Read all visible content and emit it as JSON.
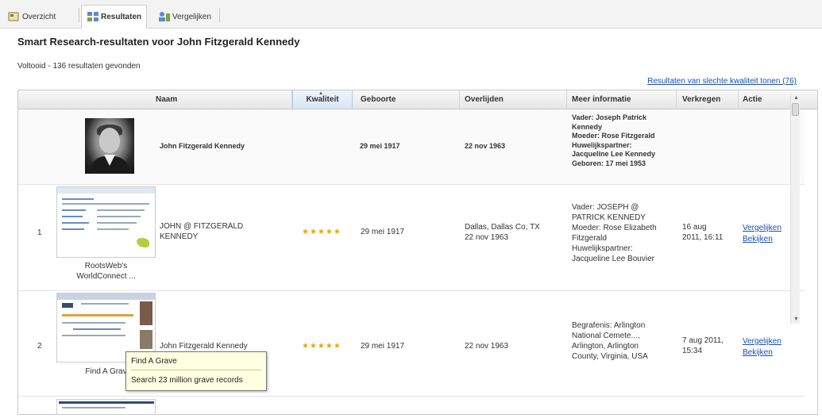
{
  "tabs": [
    {
      "label": "Overzicht"
    },
    {
      "label": "Resultaten"
    },
    {
      "label": "Vergelijken"
    }
  ],
  "page_title": "Smart Research-resultaten voor John Fitzgerald Kennedy",
  "status": "Voltooid - 136 resultaten gevonden",
  "low_quality_link": "Resultaten van slechte kwaliteit tonen (76)",
  "columns": {
    "name": "Naam",
    "quality": "Kwaliteit",
    "birth": "Geboorte",
    "death": "Overlijden",
    "more": "Meer informatie",
    "acquired": "Verkregen",
    "action": "Actie"
  },
  "person": {
    "name": "John Fitzgerald Kennedy",
    "birth": "29 mei 1917",
    "death": "22 nov 1963",
    "more": [
      "Vader: Joseph Patrick",
      "Kennedy",
      "Moeder: Rose Fitzgerald",
      "Huwelijkspartner:",
      "Jacqueline Lee Kennedy",
      "Geboren: 17 mei 1953"
    ]
  },
  "results": [
    {
      "index": "1",
      "thumb_caption": [
        "RootsWeb's",
        "WorldConnect ..."
      ],
      "name": [
        "JOHN @ FITZGERALD",
        "KENNEDY"
      ],
      "stars": "★★★★★",
      "birth": "29 mei 1917",
      "death": [
        "Dallas, Dallas Co, TX",
        "22 nov 1963"
      ],
      "more": [
        "Vader: JOSEPH @",
        "PATRICK KENNEDY",
        "Moeder: Rose Elizabeth",
        "Fitzgerald",
        "Huwelijkspartner:",
        "Jacqueline Lee Bouvier"
      ],
      "acquired": [
        "16 aug",
        "2011, 16:11"
      ],
      "action_compare": "Vergelijken",
      "action_view": "Bekijken"
    },
    {
      "index": "2",
      "thumb_caption": [
        "Find A Grav"
      ],
      "name": [
        "John Fitzgerald Kennedy"
      ],
      "stars": "★★★★★",
      "birth": "29 mei 1917",
      "death": [
        "22 nov 1963"
      ],
      "more": [
        "Begrafenis: Arlington",
        "National Cemete...,",
        "Arlington, Arlington",
        "County, Virginia, USA"
      ],
      "acquired": [
        "7 aug 2011,",
        "15:34"
      ],
      "action_compare": "Vergelijken",
      "action_view": "Bekijken"
    }
  ],
  "tooltip": {
    "title": "Find A Grave",
    "text": "Search 23 million grave records"
  },
  "colors": {
    "link": "#1a4fb0",
    "stars": "#f0a500",
    "tooltip_bg": "#ffffe1"
  }
}
